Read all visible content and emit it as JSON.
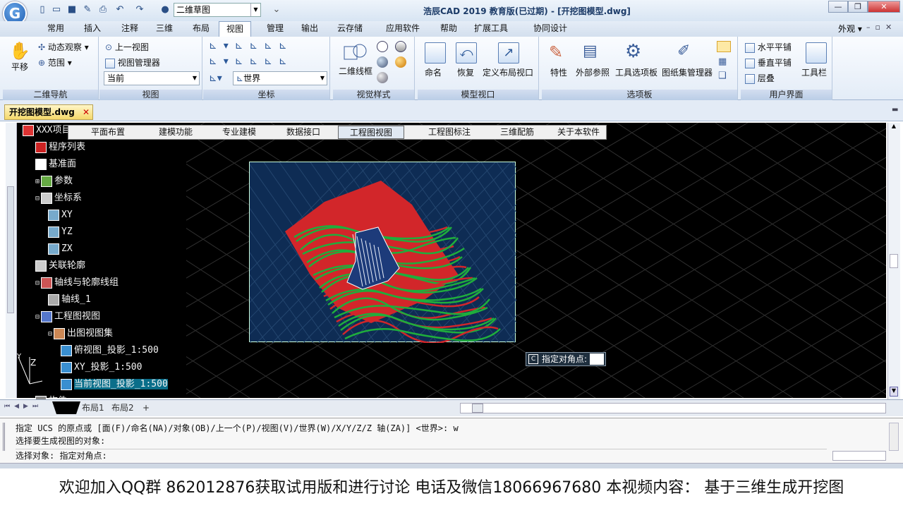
{
  "app": {
    "title": "浩辰CAD 2019 教育版(已过期) - [开挖图模型.dwg]",
    "logo_letter": "G",
    "workspace": "二维草图",
    "right_menu": "外观"
  },
  "menu_tabs": [
    "常用",
    "插入",
    "注释",
    "三维",
    "布局",
    "视图",
    "管理",
    "输出",
    "云存储",
    "应用软件",
    "帮助",
    "扩展工具",
    "协同设计"
  ],
  "active_menu": "视图",
  "ribbon": {
    "nav": {
      "label": "二维导航",
      "pan": "平移",
      "orbit": "动态观察",
      "extent": "范围"
    },
    "views": {
      "label": "视图",
      "prev": "上一视图",
      "manager": "视图管理器",
      "current": "当前"
    },
    "coords": {
      "label": "坐标",
      "world": "世界"
    },
    "visual": {
      "label": "视觉样式",
      "wireframe": "二维线框"
    },
    "model_viewports": {
      "label": "模型视口",
      "name": "命名",
      "restore": "恢复",
      "define": "定义布局视口"
    },
    "palettes": {
      "label": "选项板",
      "props": "特性",
      "xref": "外部参照",
      "toolpal": "工具选项板",
      "sheetset": "图纸集管理器"
    },
    "ui": {
      "label": "用户界面",
      "tile_h": "水平平铺",
      "tile_v": "垂直平铺",
      "cascade": "层叠",
      "toolbars": "工具栏"
    }
  },
  "doc_tab": "开挖图模型.dwg",
  "plugin_toolbar": [
    "平面布置",
    "建模功能",
    "专业建模",
    "数据接口",
    "工程图视图",
    "工程图标注",
    "三维配筋",
    "关于本软件"
  ],
  "plugin_active": "工程图视图",
  "tree": [
    {
      "label": "XXX项目",
      "indent": 0,
      "exp": "",
      "ico": "proj"
    },
    {
      "label": "程序列表",
      "indent": 1,
      "exp": "",
      "ico": "P"
    },
    {
      "label": "基准面",
      "indent": 1,
      "exp": "",
      "ico": "Z"
    },
    {
      "label": "参数",
      "indent": 1,
      "exp": "+",
      "ico": "par"
    },
    {
      "label": "坐标系",
      "indent": 1,
      "exp": "-",
      "ico": "cs"
    },
    {
      "label": "XY",
      "indent": 2,
      "exp": "",
      "ico": "ucs"
    },
    {
      "label": "YZ",
      "indent": 2,
      "exp": "",
      "ico": "ucs"
    },
    {
      "label": "ZX",
      "indent": 2,
      "exp": "",
      "ico": "ucs"
    },
    {
      "label": "关联轮廓",
      "indent": 1,
      "exp": "",
      "ico": "out"
    },
    {
      "label": "轴线与轮廓线组",
      "indent": 1,
      "exp": "-",
      "ico": "axg"
    },
    {
      "label": "轴线_1",
      "indent": 2,
      "exp": "",
      "ico": "ax"
    },
    {
      "label": "工程图视图",
      "indent": 1,
      "exp": "-",
      "ico": "vw"
    },
    {
      "label": "出图视图集",
      "indent": 2,
      "exp": "-",
      "ico": "set"
    },
    {
      "label": "俯视图_投影_1:500",
      "indent": 3,
      "exp": "",
      "ico": "v"
    },
    {
      "label": "XY_投影_1:500",
      "indent": 3,
      "exp": "",
      "ico": "v"
    },
    {
      "label": "当前视图_投影_1:500",
      "indent": 3,
      "exp": "",
      "ico": "v",
      "selected": true
    },
    {
      "label": "构件",
      "indent": 1,
      "exp": "",
      "ico": "c"
    }
  ],
  "prompt_text": "指定对角点:",
  "layout_tabs": [
    "布局1",
    "布局2",
    "+"
  ],
  "command_lines": [
    "指定 UCS 的原点或 [面(F)/命名(NA)/对象(OB)/上一个(P)/视图(V)/世界(W)/X/Y/Z/Z 轴(ZA)] <世界>: w",
    "选择要生成视图的对象:",
    "选择对象: 指定对角点:"
  ],
  "footer": "欢迎加入QQ群 862012876获取试用版和进行讨论 电话及微信18066967680 本视频内容：  基于三维生成开挖图",
  "colors": {
    "accent": "#1f5fb3",
    "canvas": "#000000",
    "preview_bg": "#0e2c54",
    "terrain_red": "#d2262a",
    "terrain_green": "#1fae3c",
    "selection": "#0a6e8a"
  }
}
